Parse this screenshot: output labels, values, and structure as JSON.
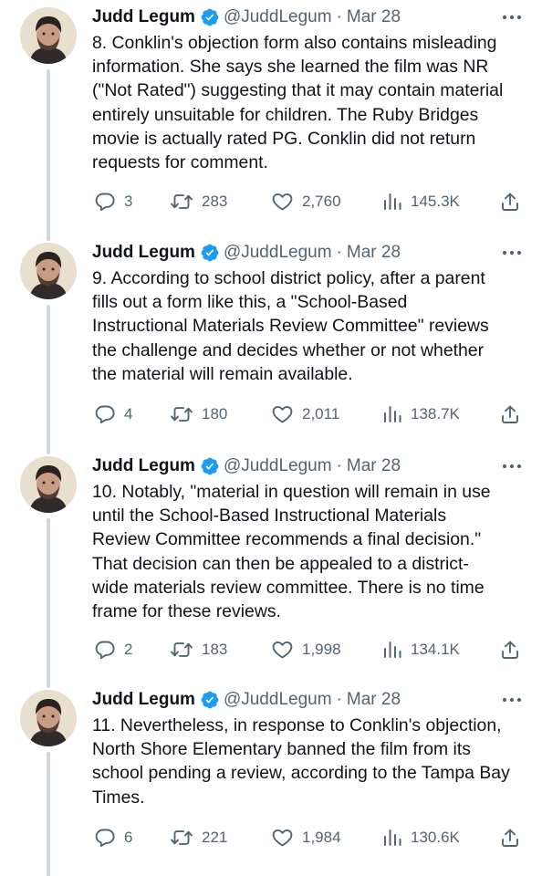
{
  "colors": {
    "text": "#0f1419",
    "secondary": "#536471",
    "verified": "#1d9bf0",
    "thread": "#cfd9de"
  },
  "tweets": [
    {
      "author": {
        "name": "Judd Legum",
        "handle": "@JuddLegum",
        "avatar_icon": "avatar-photo"
      },
      "date": "Mar 28",
      "body": [
        "8. Conklin's objection form also contains misleading",
        "information. She says she learned the film was NR",
        "(\"Not Rated\") suggesting that it may contain material",
        "entirely unsuitable for children. The Ruby Bridges",
        "movie is actually rated PG. Conklin did not return",
        "requests for comment."
      ],
      "replies": "3",
      "retweets": "283",
      "likes": "2,760",
      "views": "145.3K"
    },
    {
      "author": {
        "name": "Judd Legum",
        "handle": "@JuddLegum",
        "avatar_icon": "avatar-photo"
      },
      "date": "Mar 28",
      "body": [
        "9. According to school district policy, after a parent",
        "fills out a form like this, a \"School-Based",
        "Instructional Materials Review Committee\" reviews",
        "the challenge and decides whether or not whether",
        "the material will remain available."
      ],
      "replies": "4",
      "retweets": "180",
      "likes": "2,011",
      "views": "138.7K"
    },
    {
      "author": {
        "name": "Judd Legum",
        "handle": "@JuddLegum",
        "avatar_icon": "avatar-photo"
      },
      "date": "Mar 28",
      "body": [
        "10. Notably, \"material in question will remain in use",
        "until the School-Based Instructional Materials",
        "Review Committee recommends a final decision.\"",
        "That decision can then be appealed to a district-",
        "wide materials review committee. There is no time",
        "frame for these reviews."
      ],
      "replies": "2",
      "retweets": "183",
      "likes": "1,998",
      "views": "134.1K"
    },
    {
      "author": {
        "name": "Judd Legum",
        "handle": "@JuddLegum",
        "avatar_icon": "avatar-photo"
      },
      "date": "Mar 28",
      "body": [
        "11. Nevertheless, in response to Conklin's objection,",
        "North Shore Elementary banned the film from its",
        "school pending a review, according to the Tampa Bay",
        "Times."
      ],
      "replies": "6",
      "retweets": "221",
      "likes": "1,984",
      "views": "130.6K"
    }
  ],
  "icons": {
    "separator": "·",
    "verified": "verified-badge-icon",
    "more": "more-options-icon",
    "reply": "reply-icon",
    "retweet": "retweet-icon",
    "like": "like-icon",
    "views": "views-icon",
    "share": "share-icon"
  }
}
